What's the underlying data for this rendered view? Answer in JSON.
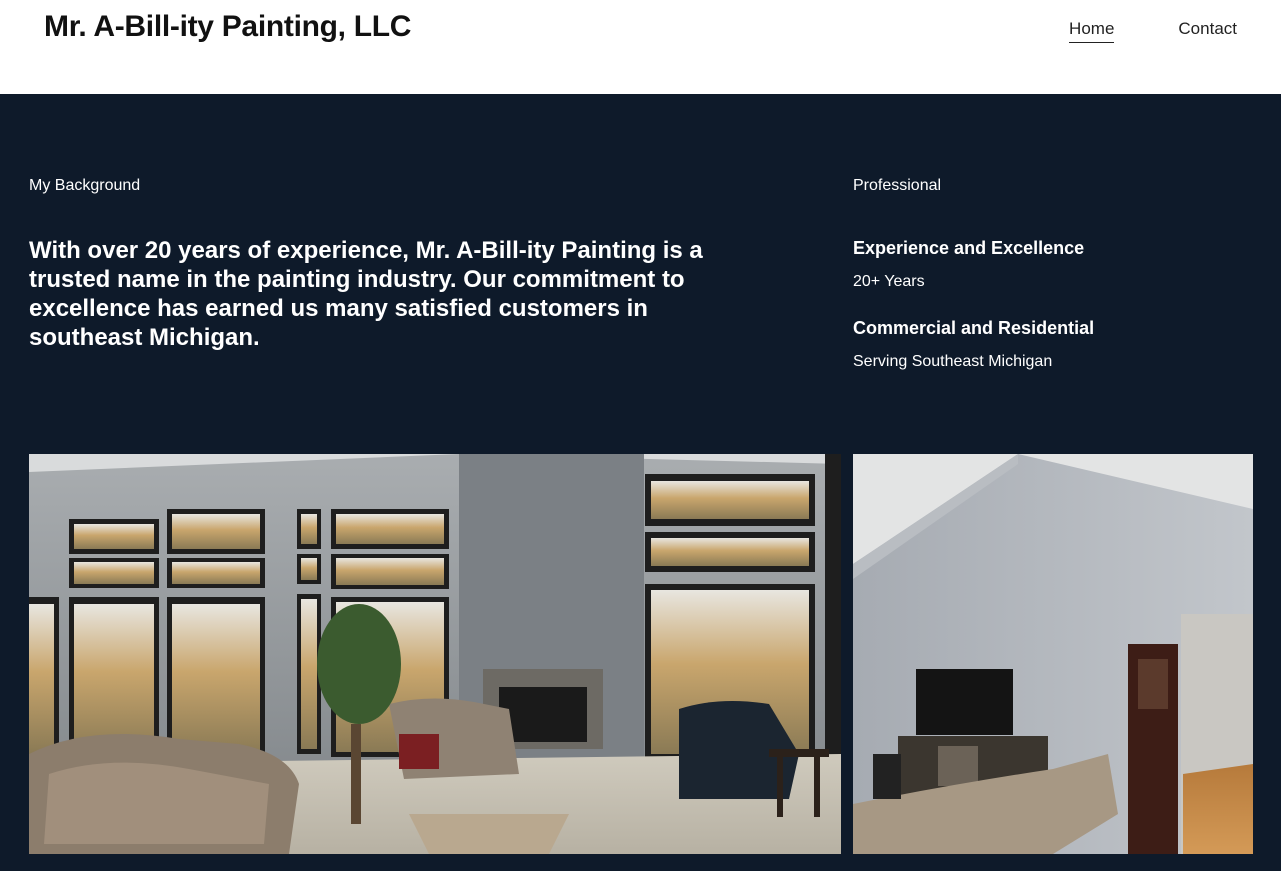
{
  "header": {
    "site_title": "Mr. A-Bill-ity Painting, LLC",
    "nav": {
      "home": "Home",
      "contact": "Contact"
    }
  },
  "about": {
    "eyebrow": "My Background",
    "headline": "With over 20 years of experience, Mr. A-Bill-ity Painting is a trusted name in the painting industry. Our commitment to excellence has earned us many satisfied customers in southeast Michigan."
  },
  "professional": {
    "eyebrow": "Professional",
    "stats": [
      {
        "title": "Experience and Excellence",
        "value": "20+ Years"
      },
      {
        "title": "Commercial and Residential",
        "value": "Serving Southeast Michigan"
      }
    ]
  },
  "colors": {
    "background": "#0e1a2a",
    "header_bg": "#ffffff",
    "text_light": "#ffffff",
    "text_dark": "#111111"
  }
}
